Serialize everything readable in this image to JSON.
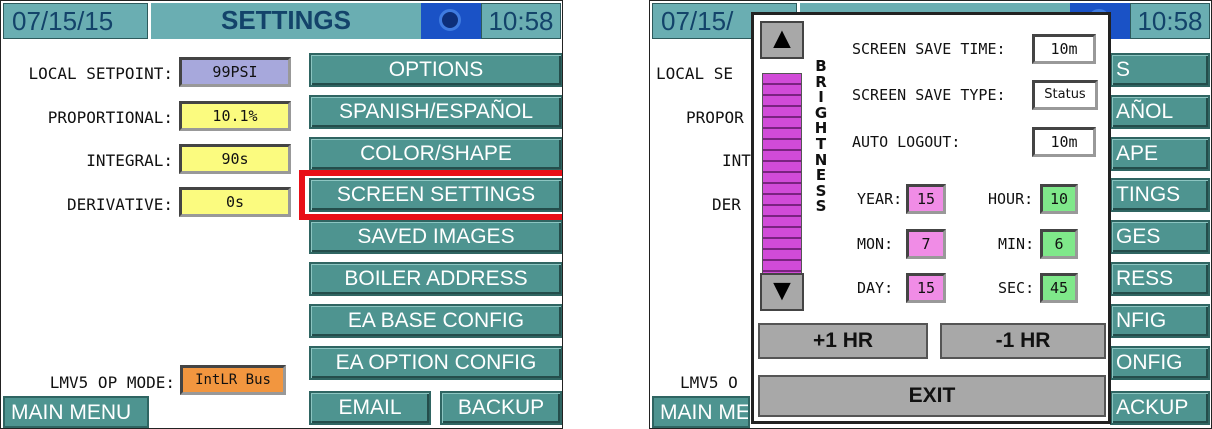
{
  "left": {
    "header": {
      "date": "07/15/15",
      "title": "SETTINGS",
      "time": "10:58",
      "camera_icon": "camera-icon"
    },
    "fields": [
      {
        "label": "LOCAL SETPOINT:",
        "value": "99PSI",
        "color": "#a7a8dc"
      },
      {
        "label": "PROPORTIONAL:",
        "value": "10.1%",
        "color": "#fbfb7f"
      },
      {
        "label": "INTEGRAL:",
        "value": "90s",
        "color": "#fbfb7f"
      },
      {
        "label": "DERIVATIVE:",
        "value": "0s",
        "color": "#fbfb7f"
      }
    ],
    "mode": {
      "label": "LMV5 OP MODE:",
      "value": "IntLR Bus",
      "color": "#f2963f"
    },
    "buttons": [
      "OPTIONS",
      "SPANISH/ESPAÑOL",
      "COLOR/SHAPE",
      "SCREEN SETTINGS",
      "SAVED IMAGES",
      "BOILER ADDRESS",
      "EA BASE CONFIG",
      "EA OPTION CONFIG",
      "EMAIL",
      "BACKUP"
    ],
    "main_menu": "MAIN MENU",
    "highlight_color": "#e81018"
  },
  "right": {
    "header": {
      "date": "07/15/",
      "time": "10:58"
    },
    "background_labels": {
      "local": "LOCAL SE",
      "propor": "PROPOR",
      "int": "INT",
      "der": "DER",
      "lmv": "LMV5 O",
      "menu": "MAIN ME"
    },
    "background_buttons": [
      "S",
      "AÑOL",
      "APE",
      "TINGS",
      "GES",
      "RESS",
      "NFIG",
      "ONFIG",
      "ACKUP"
    ],
    "dialog": {
      "brightness_letters": [
        "B",
        "R",
        "I",
        "G",
        "H",
        "T",
        "N",
        "E",
        "S",
        "S"
      ],
      "up_arrow": "▲",
      "down_arrow": "▼",
      "screen_save_time_label": "SCREEN SAVE TIME:",
      "screen_save_time": "10m",
      "screen_save_type_label": "SCREEN SAVE TYPE:",
      "screen_save_type": "Status",
      "auto_logout_label": "AUTO LOGOUT:",
      "auto_logout": "10m",
      "year_label": "YEAR:",
      "year": "15",
      "mon_label": "MON:",
      "mon": "7",
      "day_label": "DAY:",
      "day": "15",
      "hour_label": "HOUR:",
      "hour": "10",
      "min_label": "MIN:",
      "min": "6",
      "sec_label": "SEC:",
      "sec": "45",
      "plus_hr": "+1 HR",
      "minus_hr": "-1 HR",
      "exit": "EXIT",
      "date_color": "#f08ce6",
      "time_color": "#7fe88a"
    }
  }
}
